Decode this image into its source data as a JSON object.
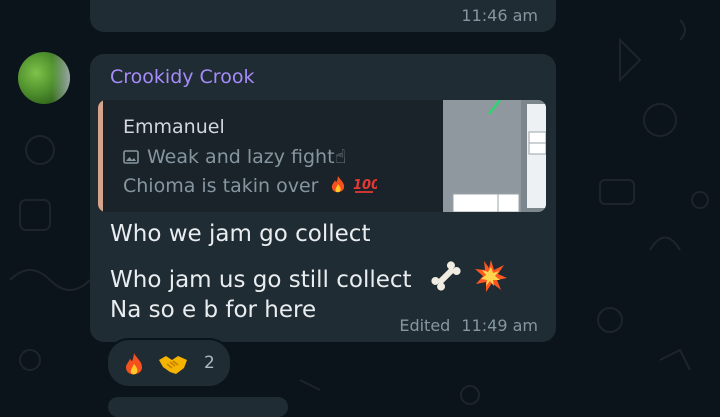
{
  "previous_message": {
    "time": "11:46 am"
  },
  "message": {
    "sender": "Crookidy Crook",
    "quote": {
      "author": "Emmanuel",
      "line1": "Weak and lazy fight☝",
      "line2": "Chioma is takin over",
      "attachment_icon": "image-icon"
    },
    "lines": [
      "Who we jam go collect",
      "Who jam us go still collect",
      "Na so e b for here"
    ],
    "edited_label": "Edited",
    "time": "11:49 am"
  },
  "reactions": {
    "count": "2",
    "emojis": [
      "fire",
      "handshake"
    ]
  },
  "colors": {
    "background": "#0b141a",
    "bubble": "#202c33",
    "sender": "#a78bfa",
    "quote_bar": "#d4a48c"
  }
}
